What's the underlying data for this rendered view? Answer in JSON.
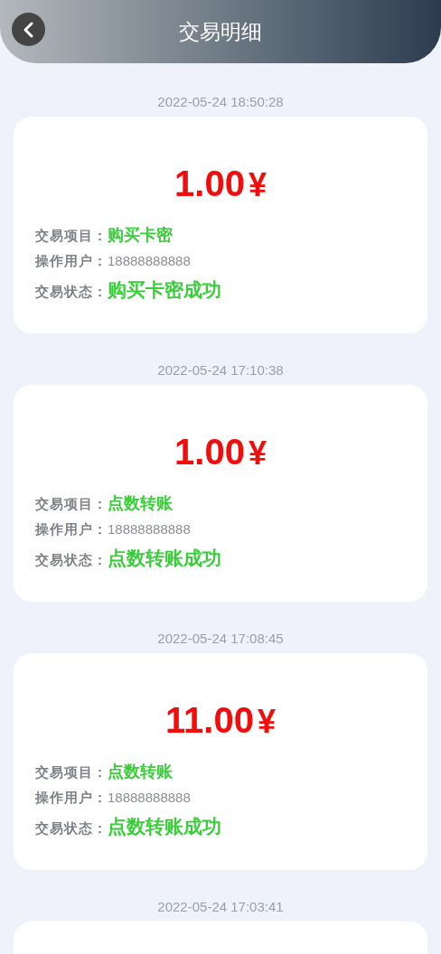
{
  "header": {
    "title": "交易明细"
  },
  "records": [
    {
      "time": "2022-05-24 18:50:28",
      "amount": "1.00",
      "currency": "¥",
      "item_label": "交易项目：",
      "item": "购买卡密",
      "user_label": "操作用户：",
      "user": "18888888888",
      "status_label": "交易状态：",
      "status": "购买卡密成功"
    },
    {
      "time": "2022-05-24 17:10:38",
      "amount": "1.00",
      "currency": "¥",
      "item_label": "交易项目：",
      "item": "点数转账",
      "user_label": "操作用户：",
      "user": "18888888888",
      "status_label": "交易状态：",
      "status": "点数转账成功"
    },
    {
      "time": "2022-05-24 17:08:45",
      "amount": "11.00",
      "currency": "¥",
      "item_label": "交易项目：",
      "item": "点数转账",
      "user_label": "操作用户：",
      "user": "18888888888",
      "status_label": "交易状态：",
      "status": "点数转账成功"
    },
    {
      "time": "2022-05-24 17:03:41"
    }
  ]
}
